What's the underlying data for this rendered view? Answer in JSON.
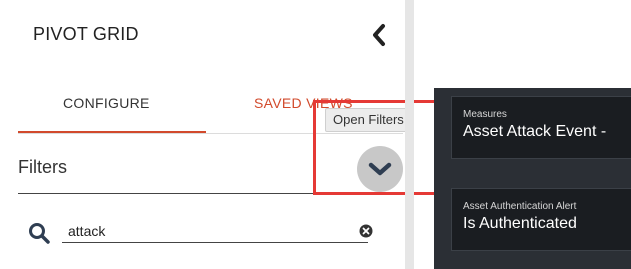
{
  "sidebar": {
    "title": "PIVOT GRID",
    "tabs": [
      {
        "label": "CONFIGURE",
        "active": true
      },
      {
        "label": "SAVED VIEWS",
        "active": false
      }
    ],
    "filters_label": "Filters",
    "open_filters_tooltip": "Open Filters",
    "search": {
      "value": "attack",
      "placeholder": ""
    }
  },
  "grid": {
    "cards": [
      {
        "label": "Measures",
        "value": "Asset Attack Event -"
      },
      {
        "label": "Asset Authentication Alert",
        "value": "Is Authenticated"
      }
    ]
  },
  "colors": {
    "accent": "#d24a2c",
    "highlight": "#e53935",
    "panel_dark": "#2b2f35",
    "card_bg": "#1a1d21"
  },
  "icons": [
    "chevron-left-icon",
    "chevron-down-icon",
    "search-icon",
    "clear-icon",
    "kebab-menu-icon"
  ]
}
